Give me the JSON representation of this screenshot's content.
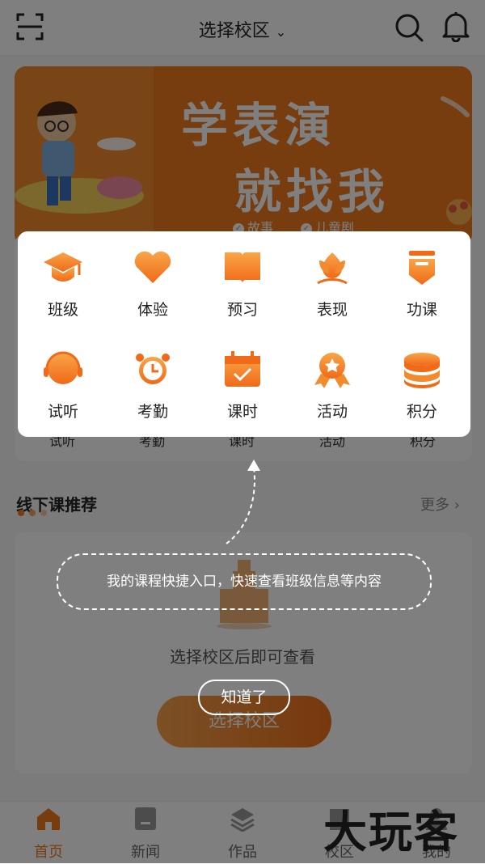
{
  "header": {
    "title": "选择校区",
    "chevron": "chevron-down-icon"
  },
  "banner": {
    "line1": "学表演",
    "line2": "就找我",
    "tags": [
      "故事",
      "儿童剧"
    ]
  },
  "quick_menu": [
    {
      "label": "班级",
      "icon": "graduation-cap-icon"
    },
    {
      "label": "体验",
      "icon": "heart-icon"
    },
    {
      "label": "预习",
      "icon": "open-book-icon"
    },
    {
      "label": "表现",
      "icon": "flower-icon"
    },
    {
      "label": "功课",
      "icon": "homework-icon"
    },
    {
      "label": "试听",
      "icon": "headset-icon"
    },
    {
      "label": "考勤",
      "icon": "alarm-clock-icon"
    },
    {
      "label": "课时",
      "icon": "calendar-check-icon"
    },
    {
      "label": "活动",
      "icon": "award-badge-icon"
    },
    {
      "label": "积分",
      "icon": "coin-stack-icon"
    }
  ],
  "under_labels": [
    "试听",
    "考勤",
    "课时",
    "活动",
    "积分"
  ],
  "section": {
    "title": "线下课推荐",
    "more": "更多"
  },
  "course_card": {
    "empty_text": "选择校区后即可查看",
    "button": "选择校区"
  },
  "guide": {
    "hint": "我的课程快捷入口，快速查看班级信息等内容",
    "dismiss": "知道了"
  },
  "tabbar": [
    {
      "label": "首页",
      "icon": "home-icon",
      "active": true
    },
    {
      "label": "新闻",
      "icon": "news-icon",
      "active": false
    },
    {
      "label": "作品",
      "icon": "layers-icon",
      "active": false
    },
    {
      "label": "校区",
      "icon": "campus-icon",
      "active": false
    },
    {
      "label": "我的",
      "icon": "user-icon",
      "active": false
    }
  ],
  "watermark": "大玩客",
  "colors": {
    "accent": "#f07a1e",
    "overlay": "rgba(0,0,0,0.5)"
  }
}
